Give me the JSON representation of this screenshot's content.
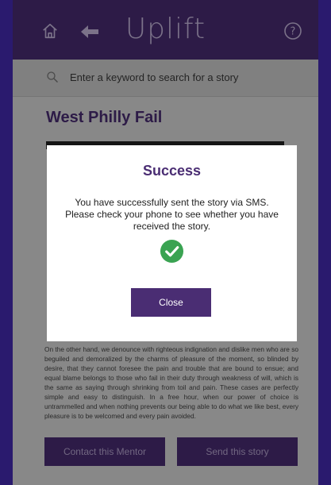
{
  "header": {
    "title": "Uplift",
    "home_icon": "home-icon",
    "back_icon": "arrow-left-icon",
    "help_icon": "help-circle-icon"
  },
  "search": {
    "placeholder": "Enter a keyword to search for a story",
    "icon": "search-icon"
  },
  "story": {
    "title": "West Philly Fail",
    "body": "On the other hand, we denounce with righteous indignation and dislike men who are so beguiled and demoralized by the charms of pleasure of the moment, so blinded by desire, that they cannot foresee the pain and trouble that are bound to ensue; and equal blame belongs to those who fail in their duty through weakness of will, which is the same as saying through shrinking from toil and pain. These cases are perfectly simple and easy to distinguish. In a free hour, when our power of choice is untrammelled and when nothing prevents our being able to do what we like best, every pleasure is to be welcomed and every pain avoided."
  },
  "actions": {
    "contact_label": "Contact this Mentor",
    "send_label": "Send this story"
  },
  "modal": {
    "title": "Success",
    "message": "You have successfully sent the story via SMS. Please check your phone to see whether you have received the story.",
    "icon": "check-circle-icon",
    "close_label": "Close"
  },
  "colors": {
    "brand_purple": "#4a2d73",
    "success_green": "#3aa352",
    "backdrop": "#2a1a6e"
  }
}
